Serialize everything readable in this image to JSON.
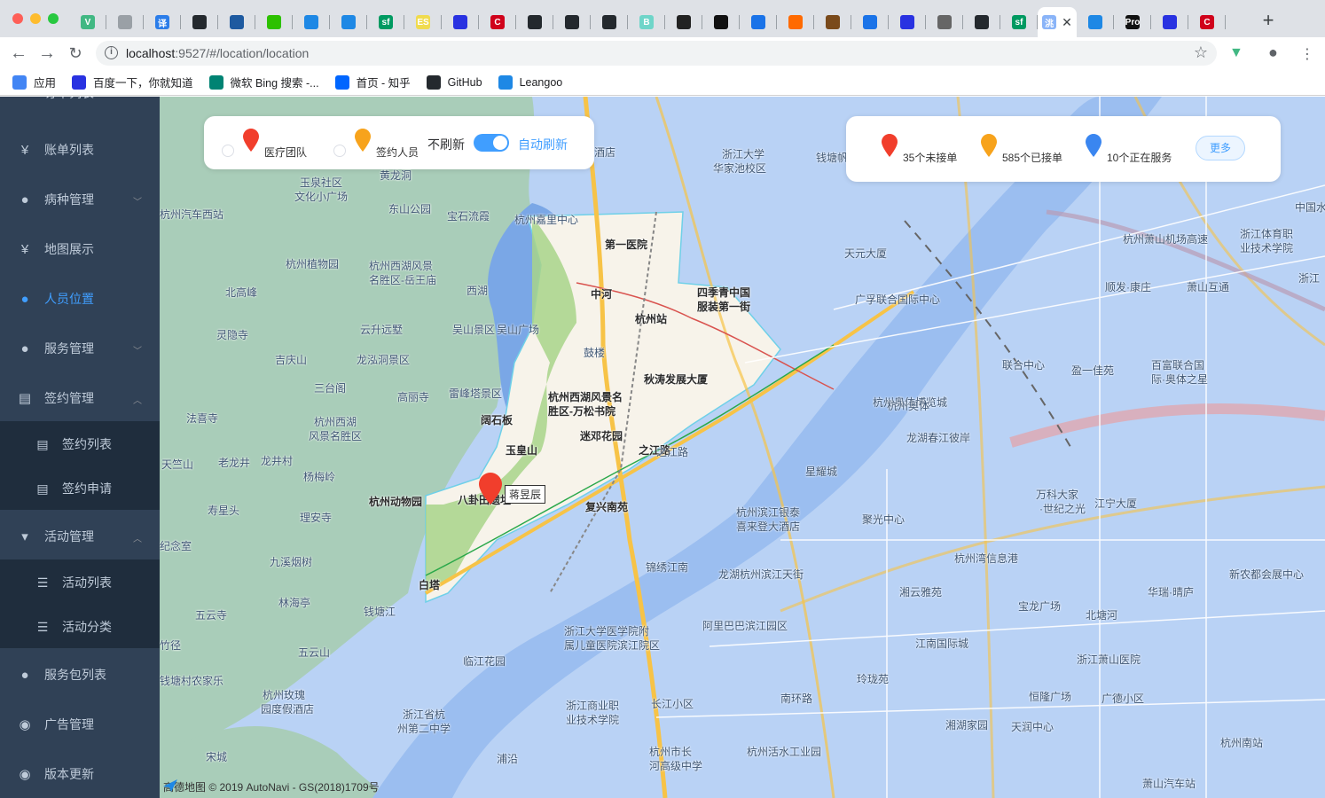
{
  "browser": {
    "url_host": "localhost",
    "url_path": ":9527/#/location/location",
    "bookmarks": [
      {
        "label": "应用",
        "icon": "apps-grid-icon",
        "color": "#4285f4"
      },
      {
        "label": "百度一下，你就知道",
        "icon": "baidu-paw-icon",
        "color": "#2932e1"
      },
      {
        "label": "微软 Bing 搜索 -...",
        "icon": "bing-icon",
        "color": "#008373"
      },
      {
        "label": "首页 - 知乎",
        "icon": "zhihu-icon",
        "color": "#0066ff"
      },
      {
        "label": "GitHub",
        "icon": "github-icon",
        "color": "#24292e"
      },
      {
        "label": "Leangoo",
        "icon": "leangoo-icon",
        "color": "#1e88e5"
      }
    ],
    "tab_favicons": [
      {
        "icon": "vue-icon",
        "color": "#41b883",
        "text": "V"
      },
      {
        "icon": "document-icon",
        "color": "#9aa0a6",
        "text": ""
      },
      {
        "icon": "translate-icon",
        "color": "#2b7de9",
        "text": "译"
      },
      {
        "icon": "github-icon",
        "color": "#24292e",
        "text": ""
      },
      {
        "icon": "diamond-icon",
        "color": "#1e5aa0",
        "text": ""
      },
      {
        "icon": "wechat-icon",
        "color": "#2dc100",
        "text": ""
      },
      {
        "icon": "hexagon-icon",
        "color": "#1e88e5",
        "text": ""
      },
      {
        "icon": "layers-icon",
        "color": "#1e88e5",
        "text": ""
      },
      {
        "icon": "segmentfault-icon",
        "color": "#009a61",
        "text": "sf"
      },
      {
        "icon": "es-icon",
        "color": "#f0db4f",
        "text": "ES"
      },
      {
        "icon": "baidu-paw-icon",
        "color": "#2932e1",
        "text": ""
      },
      {
        "icon": "c-logo-icon",
        "color": "#d0021b",
        "text": "C"
      },
      {
        "icon": "github-icon",
        "color": "#24292e",
        "text": ""
      },
      {
        "icon": "github-icon",
        "color": "#24292e",
        "text": ""
      },
      {
        "icon": "github-icon",
        "color": "#24292e",
        "text": ""
      },
      {
        "icon": "b-logo-icon",
        "color": "#6fd5c9",
        "text": "B"
      },
      {
        "icon": "mascot-icon",
        "color": "#222222",
        "text": ""
      },
      {
        "icon": "avatar-icon",
        "color": "#111111",
        "text": ""
      },
      {
        "icon": "grad-cap-icon",
        "color": "#1a73e8",
        "text": ""
      },
      {
        "icon": "code-icon",
        "color": "#ff6a00",
        "text": ""
      },
      {
        "icon": "book-icon",
        "color": "#7a4a1b",
        "text": ""
      },
      {
        "icon": "grad-cap-icon",
        "color": "#1a73e8",
        "text": ""
      },
      {
        "icon": "baidu-paw-icon",
        "color": "#2932e1",
        "text": ""
      },
      {
        "icon": "spiral-icon",
        "color": "#666666",
        "text": ""
      },
      {
        "icon": "github-icon",
        "color": "#24292e",
        "text": ""
      },
      {
        "icon": "segmentfault-icon",
        "color": "#009a61",
        "text": "sf"
      },
      {
        "icon": "active-tab-icon",
        "color": "#8ab4f8",
        "text": "洮"
      },
      {
        "icon": "hexagon-icon",
        "color": "#1e88e5",
        "text": ""
      },
      {
        "icon": "pro-icon",
        "color": "#111111",
        "text": "Pro"
      },
      {
        "icon": "baidu-paw-icon",
        "color": "#2932e1",
        "text": ""
      },
      {
        "icon": "c-logo-icon",
        "color": "#d0021b",
        "text": "C"
      }
    ]
  },
  "sidebar": {
    "items": [
      {
        "label": "订单列表",
        "icon": "list-icon",
        "glyph": "≡",
        "arrow": ""
      },
      {
        "label": "账单列表",
        "icon": "yen-icon",
        "glyph": "¥",
        "arrow": ""
      },
      {
        "label": "病种管理",
        "icon": "user-group-icon",
        "glyph": "●",
        "arrow": "﹀"
      },
      {
        "label": "地图展示",
        "icon": "yen-icon",
        "glyph": "¥",
        "arrow": ""
      },
      {
        "label": "人员位置",
        "icon": "user-group-icon",
        "glyph": "●",
        "arrow": "",
        "active": true
      },
      {
        "label": "服务管理",
        "icon": "user-group-icon",
        "glyph": "●",
        "arrow": "﹀"
      },
      {
        "label": "签约管理",
        "icon": "document-icon",
        "glyph": "▤",
        "arrow": "︿"
      },
      {
        "label": "活动管理",
        "icon": "cart-icon",
        "glyph": "▾",
        "arrow": "︿"
      },
      {
        "label": "服务包列表",
        "icon": "user-icon",
        "glyph": "●",
        "arrow": ""
      },
      {
        "label": "广告管理",
        "icon": "globe-icon",
        "glyph": "◉",
        "arrow": ""
      },
      {
        "label": "版本更新",
        "icon": "globe-icon",
        "glyph": "◉",
        "arrow": ""
      }
    ],
    "sign_sub": [
      {
        "label": "签约列表",
        "icon": "document-icon",
        "glyph": "▤"
      },
      {
        "label": "签约申请",
        "icon": "document-icon",
        "glyph": "▤"
      }
    ],
    "activity_sub": [
      {
        "label": "活动列表",
        "icon": "list-icon",
        "glyph": "☰"
      },
      {
        "label": "活动分类",
        "icon": "list-icon",
        "glyph": "☰"
      }
    ]
  },
  "filter_panel": {
    "medical_team_label": "医疗团队",
    "signed_staff_label": "签约人员",
    "no_refresh_label": "不刷新",
    "auto_refresh_label": "自动刷新",
    "auto_refresh_on": true
  },
  "stats_panel": {
    "unaccepted": "35个未接单",
    "accepted": "585个已接单",
    "serving": "10个正在服务",
    "more_label": "更多"
  },
  "map": {
    "person_name": "蒋昱辰",
    "copyright": "高德地图 © 2019 AutoNavi - GS(2018)1709号",
    "labels": [
      "玉泉社区",
      "文化小广场",
      "黄龙洞",
      "东山公园",
      "宝石流霞",
      "杭州嘉里中心",
      "酒店",
      "杭州汽车西站",
      "杭州植物园",
      "杭州西湖风景",
      "名胜区-岳王庙",
      "北高峰",
      "灵隐寺",
      "西湖",
      "云升远墅",
      "吴山景区",
      "吴山广场",
      "鼓楼",
      "吉庆山",
      "龙泓洞景区",
      "三台阁",
      "高丽寺",
      "雷峰塔景区",
      "法喜寺",
      "杭州西湖",
      "风景名胜区",
      "天竺山",
      "老龙井",
      "龙井村",
      "杨梅岭",
      "寿星头",
      "理安寺",
      "九溪烟树",
      "林海亭",
      "五云寺",
      "竹径",
      "五云山",
      "钱塘江",
      "杭州玫瑰",
      "园度假酒店",
      "宋城",
      "钱塘村农家乐",
      "第一医院",
      "中河",
      "杭州站",
      "四季青中国",
      "服装第一街",
      "秋涛发展大厦",
      "杭州西湖风景名",
      "胜区-万松书院",
      "迷邓花园",
      "阔石板",
      "玉皇山",
      "八卦田遗址",
      "杭州动物园",
      "复兴南苑",
      "白塔",
      "之江路",
      "浙江大学",
      "华家池校区",
      "钱塘帆影",
      "天元大厦",
      "广孚联合国际中心",
      "杭州奥体博览城",
      "龙湖春江彼岸",
      "星耀城",
      "杭州滨江银泰",
      "喜来登大酒店",
      "聚光中心",
      "联合中心",
      "盈一佳苑",
      "百富联合国",
      "际·奥体之星",
      "万科大家",
      "·世纪之光",
      "江宁大厦",
      "杭州湾信息港",
      "宝龙广场",
      "锦绣江南",
      "龙湖杭州滨江天街",
      "湘云雅苑",
      "阿里巴巴滨江园区",
      "江南国际城",
      "玲珑苑",
      "浙江大学医学院附",
      "属儿童医院滨江院区",
      "临江花园",
      "浙江省杭",
      "州第二中学",
      "长江小区",
      "浙江商业职",
      "业技术学院",
      "杭州市长",
      "河高级中学",
      "杭州活水工业园",
      "湘湖家园",
      "天润中心",
      "恒隆广场",
      "广德小区",
      "浙江萧山医院",
      "杭州南站",
      "萧山汽车站",
      "浦沿",
      "新农都会展中心",
      "华瑞·晴庐",
      "浙江体育职",
      "业技术学院",
      "顺发·康庄",
      "萧山互通",
      "杭州萧山机场高速",
      "杭州奥体",
      "中国水",
      "浙江",
      "纪念室",
      "北塘河",
      "南环路",
      "之江路"
    ]
  }
}
